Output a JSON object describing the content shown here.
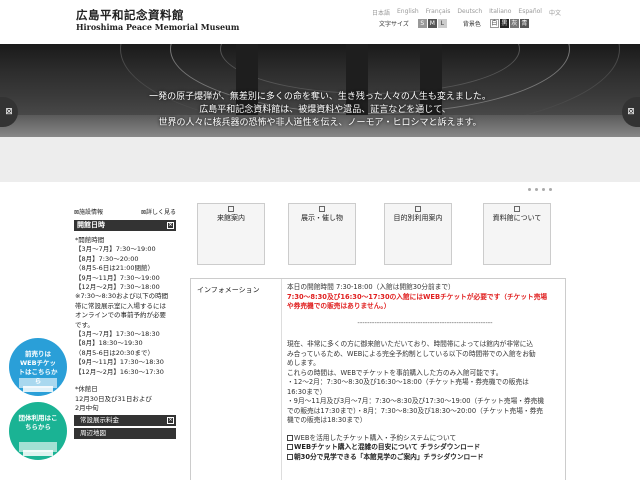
{
  "header": {
    "logo_jp": "広島平和記念資料館",
    "logo_en": "Hiroshima Peace Memorial Museum",
    "languages": [
      "日本語",
      "English",
      "Français",
      "Deutsch",
      "Italiano",
      "Español",
      "中文"
    ],
    "text_size_label": "文字サイズ",
    "size_s": "S",
    "size_m": "M",
    "size_l": "L",
    "bg_color_label": "背景色",
    "bg_white": "白",
    "bg_black": "黒",
    "bg_gray": "灰",
    "bg_blue": "青"
  },
  "hero": {
    "line1": "一発の原子爆弾が、無差別に多くの命を奪い、生き残った人々の人生も変えました。",
    "line2": "広島平和記念資料館は、被爆資料や遺品、証言などを通じて、",
    "line3": "世界の人々に核兵器の恐怖や非人道性を伝え、ノーモア・ヒロシマと訴えます。"
  },
  "sidebar": {
    "facility_info": "施設情報",
    "details": "詳しく見る",
    "hours_title": "開館日時",
    "hours_lines": [
      "*開館時間",
      "【3月～7月】7:30～19:00",
      "【8月】7:30～20:00",
      "（8月5-6日は21:00閉館）",
      "【9月～11月】7:30～19:00",
      "【12月～2月】7:30～18:00",
      "※7:30～8:30および以下の時間",
      "帯に常設展示室に入場するには",
      "オンラインでの事前予約が必要",
      "です。",
      "【3月～7月】17:30～18:30",
      "【8月】18:30～19:30",
      "（8月5-6日は20:30まで）",
      "【9月～11月】17:30～18:30",
      "【12月～2月】16:30～17:30",
      "",
      "*休館日",
      "12月30日及び31日および",
      "2月中旬"
    ],
    "btn_fee": "常設展示料金",
    "btn_map": "周辺地図"
  },
  "badges": {
    "web_ticket": "前売りはWEBチケットはこちらから",
    "group": "団体利用はこちらから"
  },
  "menu": [
    {
      "label": "来館案内"
    },
    {
      "label": "展示・催し物"
    },
    {
      "label": "目的別利用案内"
    },
    {
      "label": "資料館について"
    }
  ],
  "info": {
    "label": "インフォメーション",
    "line1": "本日の開館時間 7:30-18:00（入館は開館30分前まで）",
    "red1": "7:30～8:30及び16:30～17:30の入館にはWEBチケットが必要です（チケット売場",
    "red2": "や券売機での販売はありません。）",
    "dash": "--------------------------------------------------------",
    "p1": "現在、非常に多くの方に御来館いただいており、時間帯によっては館内が非常に込",
    "p2": "み合っているため、WEBによる完全予約制としている以下の時間帯での入館をお勧",
    "p3": "めします。",
    "p4": "これらの時間は、WEBでチケットを事前購入した方のみ入館可能です。",
    "p5": "・12～2月：7:30～8:30及び16:30～18:00（チケット売場・券売機での販売は",
    "p6": "16:30まで）",
    "p7": "・9月～11月及び3月～7月：7:30～8:30及び17:30～19:00（チケット売場・券売機",
    "p8": "での販売は17:30まで）・8月：7:30～8:30及び18:30～20:00（チケット売場・券売",
    "p9": "機での販売は18:30まで）",
    "q1": "WEBを活用したチケット購入・予約システムについて",
    "q2": "WEBチケット購入と混雑の目安について チラシダウンロード",
    "q3": "朝30分で見学できる「本館見学のご案内」チラシダウンロード"
  }
}
